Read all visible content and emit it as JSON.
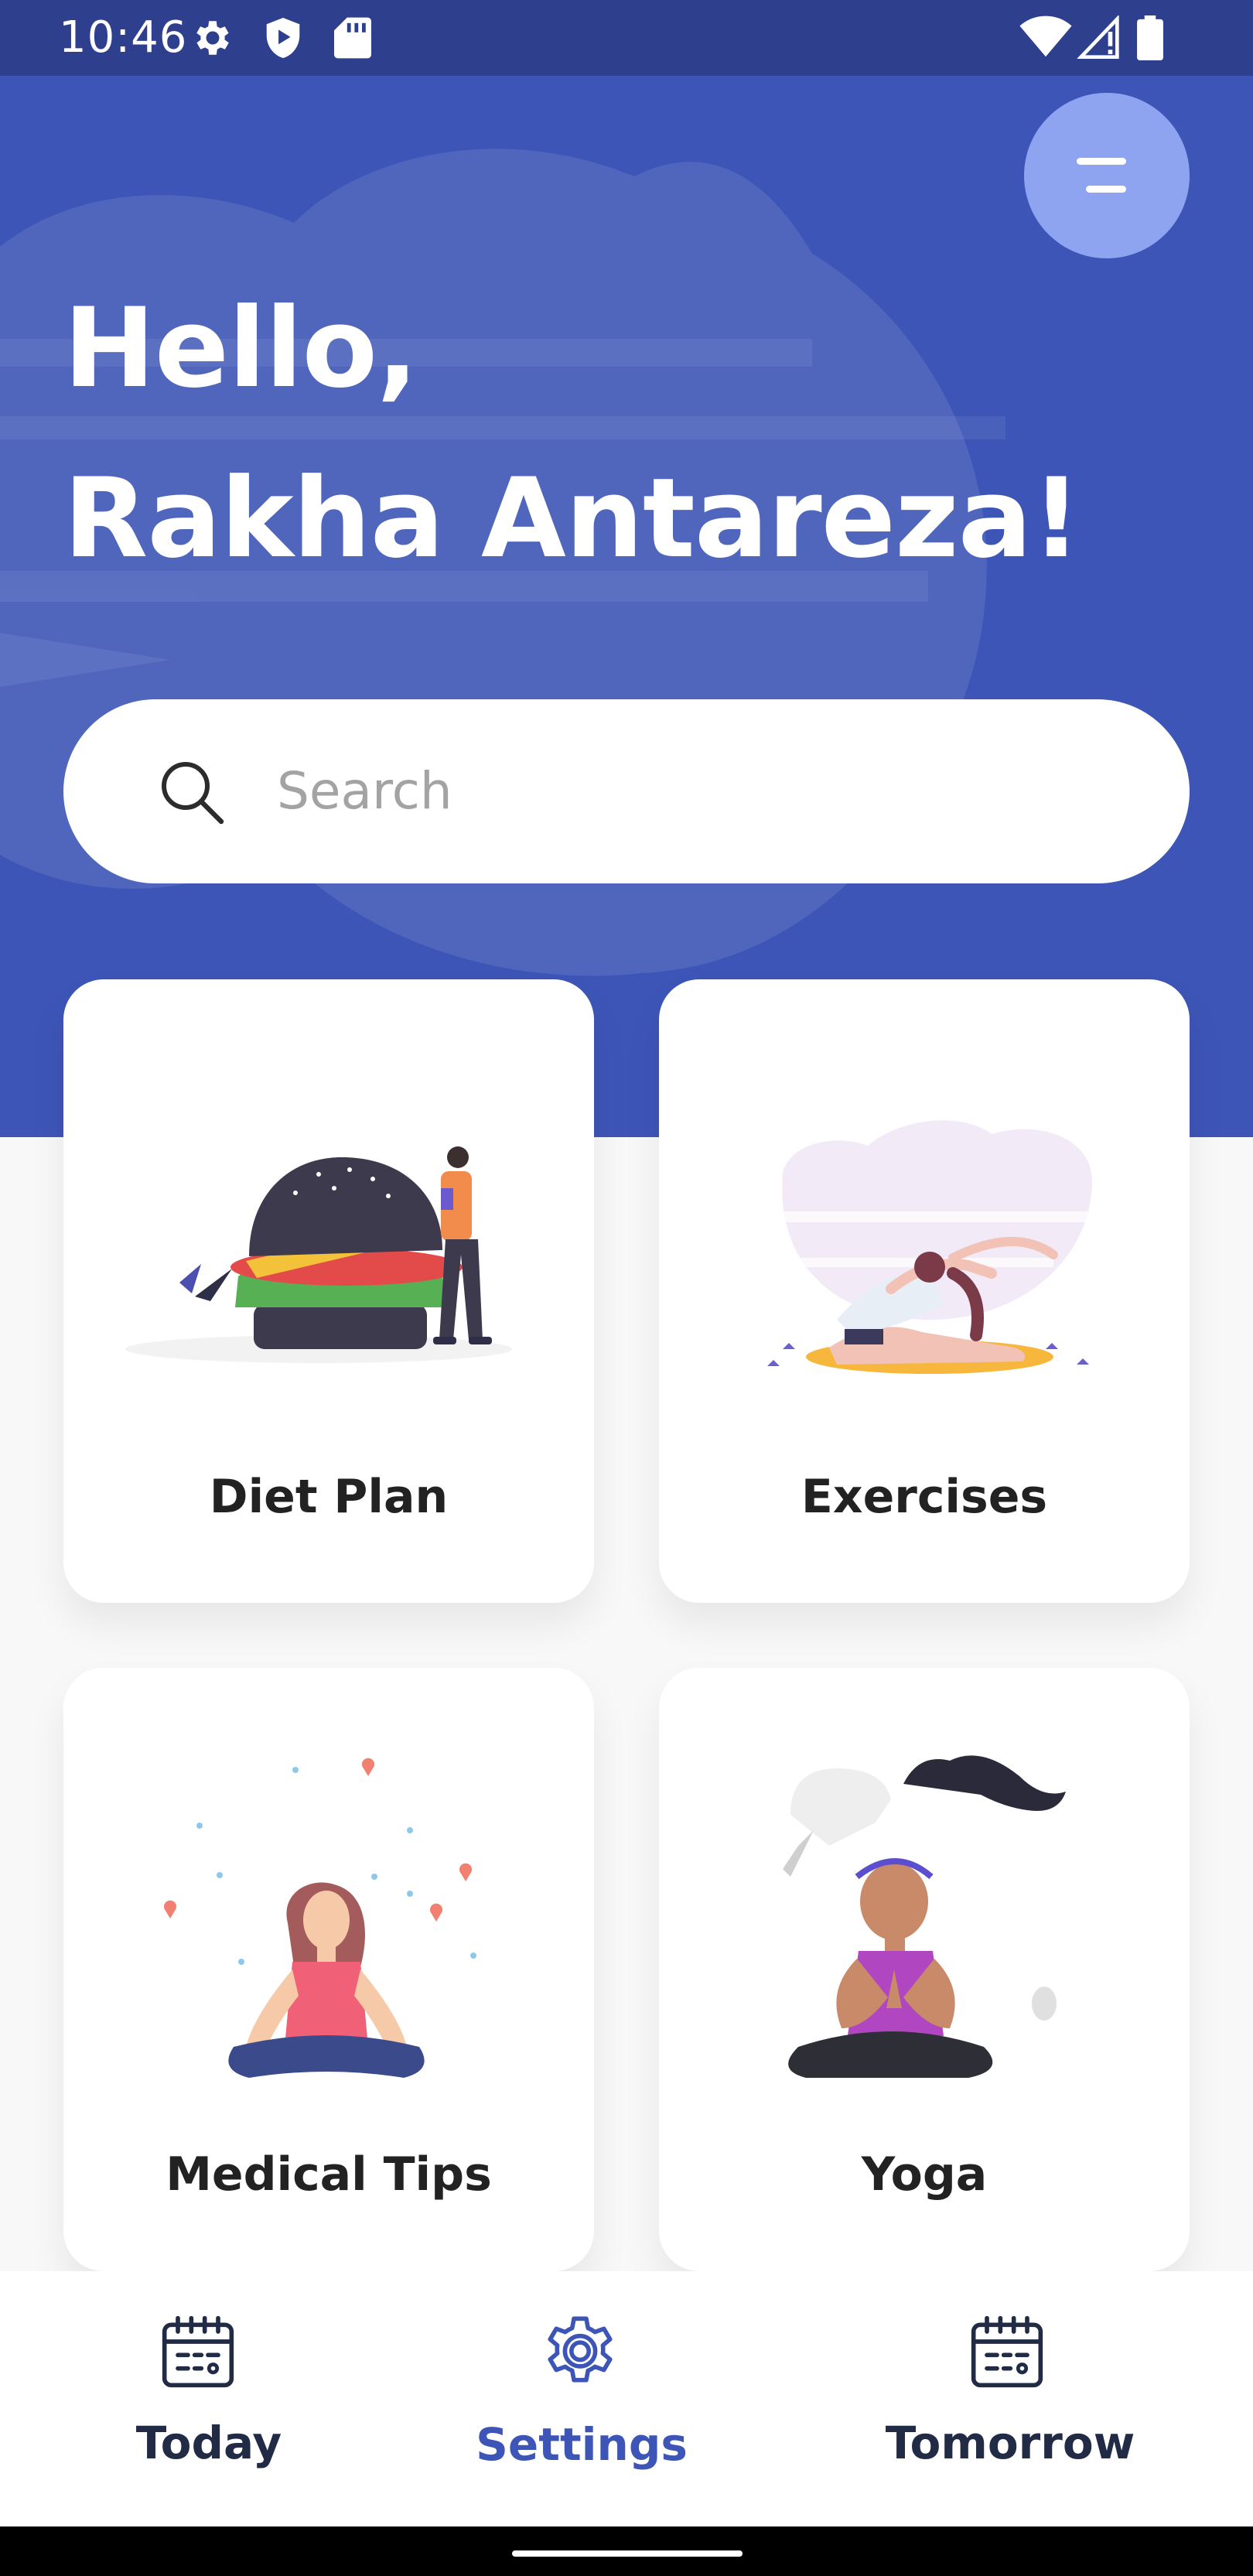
{
  "status_bar": {
    "time": "10:46",
    "left_icons": [
      "gear-icon",
      "shield-play-icon",
      "sd-card-icon"
    ],
    "right_icons": [
      "wifi-icon",
      "signal-icon",
      "battery-icon"
    ]
  },
  "header": {
    "greeting_line1": "Hello,",
    "greeting_line2": "Rakha Antareza!",
    "menu_icon": "menu-icon",
    "background_color": "#3d55b6"
  },
  "search": {
    "placeholder": "Search",
    "value": "",
    "icon": "search-icon"
  },
  "cards": [
    {
      "label": "Diet Plan",
      "illustration": "burger-illustration"
    },
    {
      "label": "Exercises",
      "illustration": "stretching-illustration"
    },
    {
      "label": "Medical Tips",
      "illustration": "meditation-illustration"
    },
    {
      "label": "Yoga",
      "illustration": "yoga-illustration"
    }
  ],
  "bottom_nav": {
    "items": [
      {
        "label": "Today",
        "icon": "calendar-icon",
        "active": false
      },
      {
        "label": "Settings",
        "icon": "gear-icon",
        "active": true
      },
      {
        "label": "Tomorrow",
        "icon": "calendar-icon",
        "active": false
      }
    ],
    "active_color": "#3d55b6",
    "inactive_color": "#222b45"
  }
}
